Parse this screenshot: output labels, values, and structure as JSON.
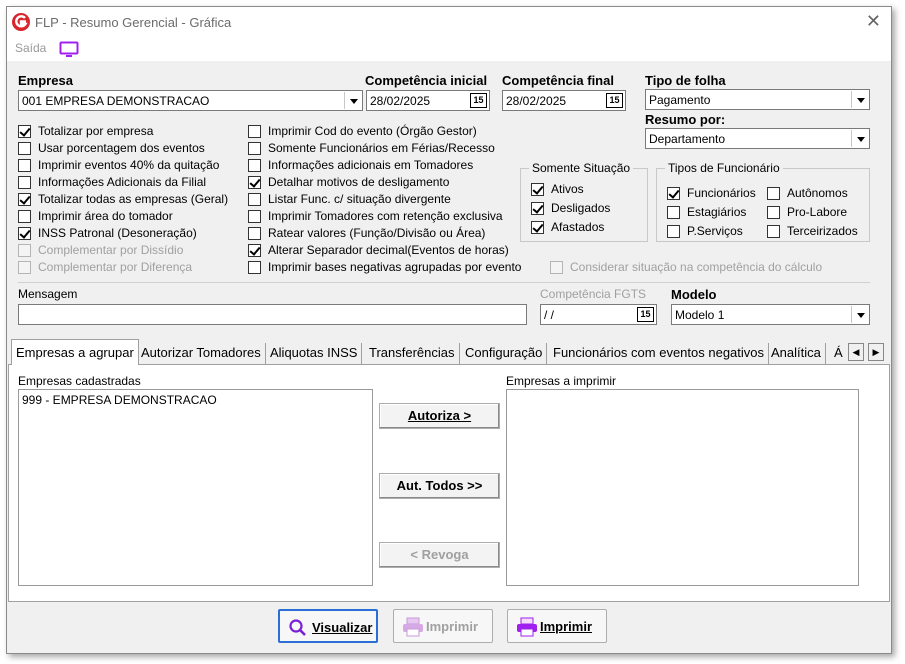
{
  "window": {
    "title": "FLP - Resumo Gerencial - Gráfica",
    "close_glyph": "✕",
    "menu": {
      "saida": "Saída"
    }
  },
  "empresa": {
    "label": "Empresa",
    "value": "001 EMPRESA DEMONSTRACAO"
  },
  "competencia_inicial": {
    "label": "Competência inicial",
    "value": "28/02/2025",
    "cal_label": "15"
  },
  "competencia_final": {
    "label": "Competência final",
    "value": "28/02/2025",
    "cal_label": "15"
  },
  "tipo_folha": {
    "label": "Tipo de folha",
    "value": "Pagamento"
  },
  "resumo_por": {
    "label": "Resumo por:",
    "value": "Departamento"
  },
  "checks_col1": [
    {
      "label": "Totalizar por empresa",
      "checked": true,
      "disabled": false
    },
    {
      "label": "Usar porcentagem dos eventos",
      "checked": false,
      "disabled": false
    },
    {
      "label": "Imprimir eventos 40% da quitação",
      "checked": false,
      "disabled": false
    },
    {
      "label": "Informações Adicionais da Filial",
      "checked": false,
      "disabled": false
    },
    {
      "label": "Totalizar todas as empresas (Geral)",
      "checked": true,
      "disabled": false
    },
    {
      "label": "Imprimir área do tomador",
      "checked": false,
      "disabled": false
    },
    {
      "label": "INSS Patronal (Desoneração)",
      "checked": true,
      "disabled": false
    },
    {
      "label": "Complementar por Dissídio",
      "checked": false,
      "disabled": true
    },
    {
      "label": "Complementar por Diferença",
      "checked": false,
      "disabled": true
    }
  ],
  "checks_col2": [
    {
      "label": "Imprimir Cod do evento (Órgão Gestor)",
      "checked": false,
      "disabled": false
    },
    {
      "label": "Somente Funcionários em Férias/Recesso",
      "checked": false,
      "disabled": false
    },
    {
      "label": "Informações adicionais em Tomadores",
      "checked": false,
      "disabled": false
    },
    {
      "label": "Detalhar motivos de desligamento",
      "checked": true,
      "disabled": false
    },
    {
      "label": "Listar Func. c/ situação divergente",
      "checked": false,
      "disabled": false
    },
    {
      "label": "Imprimir Tomadores com retenção exclusiva",
      "checked": false,
      "disabled": false
    },
    {
      "label": "Ratear valores (Função/Divisão ou Área)",
      "checked": false,
      "disabled": false
    },
    {
      "label": "Alterar Separador decimal(Eventos de horas)",
      "checked": true,
      "disabled": false
    },
    {
      "label": "Imprimir bases negativas agrupadas por evento",
      "checked": false,
      "disabled": false
    }
  ],
  "somente_situacao": {
    "title": "Somente Situação",
    "items": [
      {
        "label": "Ativos",
        "checked": true
      },
      {
        "label": "Desligados",
        "checked": true
      },
      {
        "label": "Afastados",
        "checked": true
      }
    ]
  },
  "tipos_funcionario": {
    "title": "Tipos de Funcionário",
    "items": [
      {
        "label": "Funcionários",
        "checked": true
      },
      {
        "label": "Autônomos",
        "checked": false
      },
      {
        "label": "Estagiários",
        "checked": false
      },
      {
        "label": "Pro-Labore",
        "checked": false
      },
      {
        "label": "P.Serviços",
        "checked": false
      },
      {
        "label": "Terceirizados",
        "checked": false
      }
    ]
  },
  "considerar_situacao": {
    "label": "Considerar situação na competência do cálculo",
    "checked": false,
    "disabled": true
  },
  "mensagem": {
    "label": "Mensagem",
    "value": ""
  },
  "competencia_fgts": {
    "label": "Competência FGTS",
    "value": " / /",
    "cal_label": "15"
  },
  "modelo": {
    "label": "Modelo",
    "value": "Modelo 1"
  },
  "tabs": [
    "Empresas a agrupar",
    "Autorizar Tomadores",
    "Aliquotas INSS",
    "Transferências",
    "Configuração",
    "Funcionários com eventos negativos",
    "Analítica",
    "Á"
  ],
  "tab_scroll": {
    "left": "◀",
    "right": "▶"
  },
  "empresas_cadastradas": {
    "label": "Empresas cadastradas",
    "items": [
      "999 - EMPRESA DEMONSTRACAO"
    ]
  },
  "empresas_imprimir": {
    "label": "Empresas a imprimir",
    "items": []
  },
  "transfer_buttons": {
    "autoriza": "Autoriza >",
    "aut_todos": "Aut. Todos >>",
    "revoga": "< Revoga"
  },
  "bottom_buttons": {
    "visualizar": "Visualizar",
    "imprimir_disabled": "Imprimir",
    "imprimir": "Imprimir"
  },
  "colors": {
    "brand_red": "#d9262c",
    "accent_purple": "#a020f0",
    "focus_blue": "#2b6fd6"
  }
}
